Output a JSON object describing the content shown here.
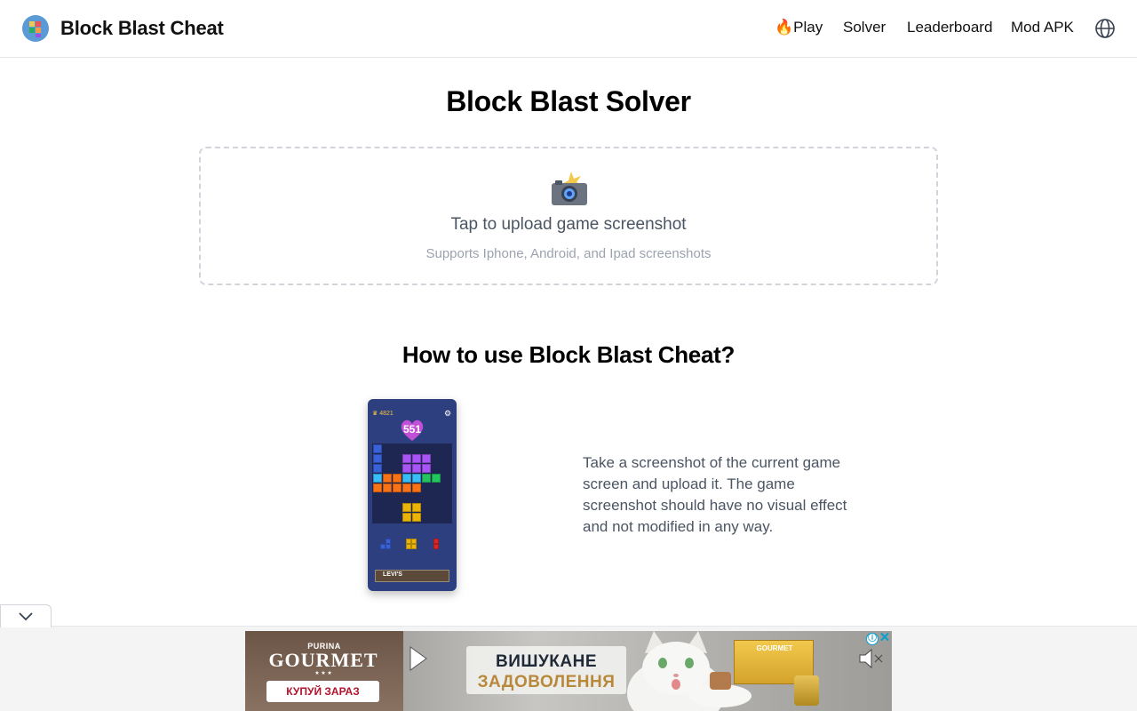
{
  "header": {
    "brand": "Block Blast Cheat",
    "logo_icon": "block-grid-logo",
    "nav": {
      "play": "🔥Play",
      "solver": "Solver",
      "leaderboard": "Leaderboard",
      "mod_apk": "Mod APK"
    },
    "language_icon": "globe-icon"
  },
  "main": {
    "title": "Block Blast Solver",
    "upload": {
      "icon": "camera-flash-icon",
      "label": "Tap to upload game screenshot",
      "hint": "Supports Iphone, Android, and Ipad screenshots"
    },
    "how_to": {
      "title": "How to use Block Blast Cheat?",
      "steps": [
        {
          "text": "Take a screenshot of the current game screen and upload it. The game screenshot should have no visual effect and not modified in any way.",
          "image": {
            "best_score": "4821",
            "score": "551",
            "banner_text": "LEVI'S"
          }
        }
      ]
    }
  },
  "ad": {
    "brand_small": "PURINA",
    "brand": "GOURMET",
    "stars": "★ ★ ★",
    "cta": "КУПУЙ ЗАРАЗ",
    "headline_1": "ВИШУКАНЕ",
    "headline_2": "ЗАДОВОЛЕННЯ",
    "product_label": "GOURMET",
    "choices_icon": "ⓘ",
    "close_label": "✕",
    "colors": {
      "cta_text": "#b3122c",
      "ad_choices": "#0aa0d0"
    }
  }
}
